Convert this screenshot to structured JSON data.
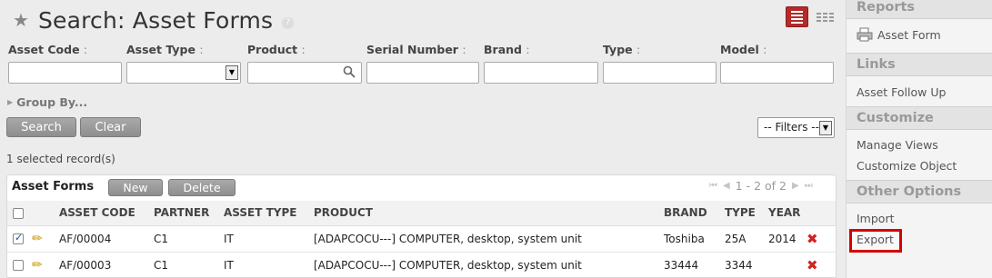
{
  "header": {
    "title": "Search: Asset Forms",
    "help": "?"
  },
  "search_fields": [
    {
      "label": "Asset Code",
      "value": "",
      "type": "text"
    },
    {
      "label": "Asset Type",
      "value": "",
      "type": "select"
    },
    {
      "label": "Product",
      "value": "",
      "type": "search"
    },
    {
      "label": "Serial Number",
      "value": "",
      "type": "text"
    },
    {
      "label": "Brand",
      "value": "",
      "type": "text"
    },
    {
      "label": "Type",
      "value": "",
      "type": "text"
    },
    {
      "label": "Model",
      "value": "",
      "type": "text"
    }
  ],
  "colon": ":",
  "groupby_label": "Group By...",
  "buttons": {
    "search": "Search",
    "clear": "Clear",
    "new": "New",
    "delete": "Delete"
  },
  "filters": {
    "selected": "-- Filters --"
  },
  "selected_count": "1 selected record(s)",
  "list": {
    "title": "Asset Forms",
    "pager": "1 - 2 of 2",
    "columns": [
      "ASSET CODE",
      "PARTNER",
      "ASSET TYPE",
      "PRODUCT",
      "BRAND",
      "TYPE",
      "YEAR"
    ],
    "rows": [
      {
        "checked": true,
        "code": "AF/00004",
        "partner": "C1",
        "asset_type": "IT",
        "product": "[ADAPCOCU---] COMPUTER, desktop, system unit",
        "brand": "Toshiba",
        "type": "25A",
        "year": "2014"
      },
      {
        "checked": false,
        "code": "AF/00003",
        "partner": "C1",
        "asset_type": "IT",
        "product": "[ADAPCOCU---] COMPUTER, desktop, system unit",
        "brand": "33444",
        "type": "3344",
        "year": ""
      }
    ]
  },
  "sidebar": {
    "reports_header": "Reports",
    "reports_item": "Asset Form",
    "links_header": "Links",
    "links_item": "Asset Follow Up",
    "customize_header": "Customize",
    "customize_items": [
      "Manage Views",
      "Customize Object"
    ],
    "other_header": "Other Options",
    "other_items": [
      "Import",
      "Export"
    ]
  },
  "colors": {
    "accent": "#b52a2a",
    "highlight_border": "#d40000",
    "delete_icon": "#d12323"
  }
}
